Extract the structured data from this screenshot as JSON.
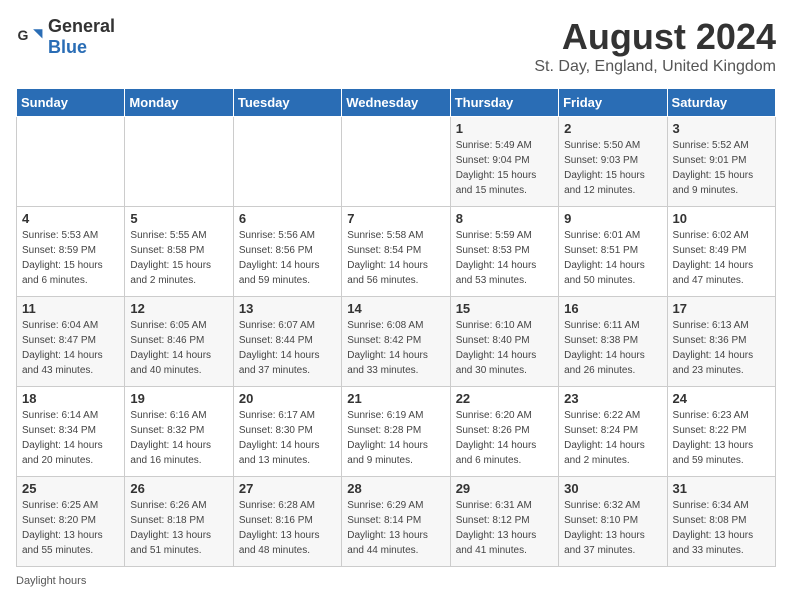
{
  "header": {
    "logo_general": "General",
    "logo_blue": "Blue",
    "main_title": "August 2024",
    "subtitle": "St. Day, England, United Kingdom"
  },
  "weekdays": [
    "Sunday",
    "Monday",
    "Tuesday",
    "Wednesday",
    "Thursday",
    "Friday",
    "Saturday"
  ],
  "weeks": [
    [
      {
        "day": "",
        "info": ""
      },
      {
        "day": "",
        "info": ""
      },
      {
        "day": "",
        "info": ""
      },
      {
        "day": "",
        "info": ""
      },
      {
        "day": "1",
        "info": "Sunrise: 5:49 AM\nSunset: 9:04 PM\nDaylight: 15 hours\nand 15 minutes."
      },
      {
        "day": "2",
        "info": "Sunrise: 5:50 AM\nSunset: 9:03 PM\nDaylight: 15 hours\nand 12 minutes."
      },
      {
        "day": "3",
        "info": "Sunrise: 5:52 AM\nSunset: 9:01 PM\nDaylight: 15 hours\nand 9 minutes."
      }
    ],
    [
      {
        "day": "4",
        "info": "Sunrise: 5:53 AM\nSunset: 8:59 PM\nDaylight: 15 hours\nand 6 minutes."
      },
      {
        "day": "5",
        "info": "Sunrise: 5:55 AM\nSunset: 8:58 PM\nDaylight: 15 hours\nand 2 minutes."
      },
      {
        "day": "6",
        "info": "Sunrise: 5:56 AM\nSunset: 8:56 PM\nDaylight: 14 hours\nand 59 minutes."
      },
      {
        "day": "7",
        "info": "Sunrise: 5:58 AM\nSunset: 8:54 PM\nDaylight: 14 hours\nand 56 minutes."
      },
      {
        "day": "8",
        "info": "Sunrise: 5:59 AM\nSunset: 8:53 PM\nDaylight: 14 hours\nand 53 minutes."
      },
      {
        "day": "9",
        "info": "Sunrise: 6:01 AM\nSunset: 8:51 PM\nDaylight: 14 hours\nand 50 minutes."
      },
      {
        "day": "10",
        "info": "Sunrise: 6:02 AM\nSunset: 8:49 PM\nDaylight: 14 hours\nand 47 minutes."
      }
    ],
    [
      {
        "day": "11",
        "info": "Sunrise: 6:04 AM\nSunset: 8:47 PM\nDaylight: 14 hours\nand 43 minutes."
      },
      {
        "day": "12",
        "info": "Sunrise: 6:05 AM\nSunset: 8:46 PM\nDaylight: 14 hours\nand 40 minutes."
      },
      {
        "day": "13",
        "info": "Sunrise: 6:07 AM\nSunset: 8:44 PM\nDaylight: 14 hours\nand 37 minutes."
      },
      {
        "day": "14",
        "info": "Sunrise: 6:08 AM\nSunset: 8:42 PM\nDaylight: 14 hours\nand 33 minutes."
      },
      {
        "day": "15",
        "info": "Sunrise: 6:10 AM\nSunset: 8:40 PM\nDaylight: 14 hours\nand 30 minutes."
      },
      {
        "day": "16",
        "info": "Sunrise: 6:11 AM\nSunset: 8:38 PM\nDaylight: 14 hours\nand 26 minutes."
      },
      {
        "day": "17",
        "info": "Sunrise: 6:13 AM\nSunset: 8:36 PM\nDaylight: 14 hours\nand 23 minutes."
      }
    ],
    [
      {
        "day": "18",
        "info": "Sunrise: 6:14 AM\nSunset: 8:34 PM\nDaylight: 14 hours\nand 20 minutes."
      },
      {
        "day": "19",
        "info": "Sunrise: 6:16 AM\nSunset: 8:32 PM\nDaylight: 14 hours\nand 16 minutes."
      },
      {
        "day": "20",
        "info": "Sunrise: 6:17 AM\nSunset: 8:30 PM\nDaylight: 14 hours\nand 13 minutes."
      },
      {
        "day": "21",
        "info": "Sunrise: 6:19 AM\nSunset: 8:28 PM\nDaylight: 14 hours\nand 9 minutes."
      },
      {
        "day": "22",
        "info": "Sunrise: 6:20 AM\nSunset: 8:26 PM\nDaylight: 14 hours\nand 6 minutes."
      },
      {
        "day": "23",
        "info": "Sunrise: 6:22 AM\nSunset: 8:24 PM\nDaylight: 14 hours\nand 2 minutes."
      },
      {
        "day": "24",
        "info": "Sunrise: 6:23 AM\nSunset: 8:22 PM\nDaylight: 13 hours\nand 59 minutes."
      }
    ],
    [
      {
        "day": "25",
        "info": "Sunrise: 6:25 AM\nSunset: 8:20 PM\nDaylight: 13 hours\nand 55 minutes."
      },
      {
        "day": "26",
        "info": "Sunrise: 6:26 AM\nSunset: 8:18 PM\nDaylight: 13 hours\nand 51 minutes."
      },
      {
        "day": "27",
        "info": "Sunrise: 6:28 AM\nSunset: 8:16 PM\nDaylight: 13 hours\nand 48 minutes."
      },
      {
        "day": "28",
        "info": "Sunrise: 6:29 AM\nSunset: 8:14 PM\nDaylight: 13 hours\nand 44 minutes."
      },
      {
        "day": "29",
        "info": "Sunrise: 6:31 AM\nSunset: 8:12 PM\nDaylight: 13 hours\nand 41 minutes."
      },
      {
        "day": "30",
        "info": "Sunrise: 6:32 AM\nSunset: 8:10 PM\nDaylight: 13 hours\nand 37 minutes."
      },
      {
        "day": "31",
        "info": "Sunrise: 6:34 AM\nSunset: 8:08 PM\nDaylight: 13 hours\nand 33 minutes."
      }
    ]
  ],
  "footer": {
    "daylight_label": "Daylight hours"
  }
}
